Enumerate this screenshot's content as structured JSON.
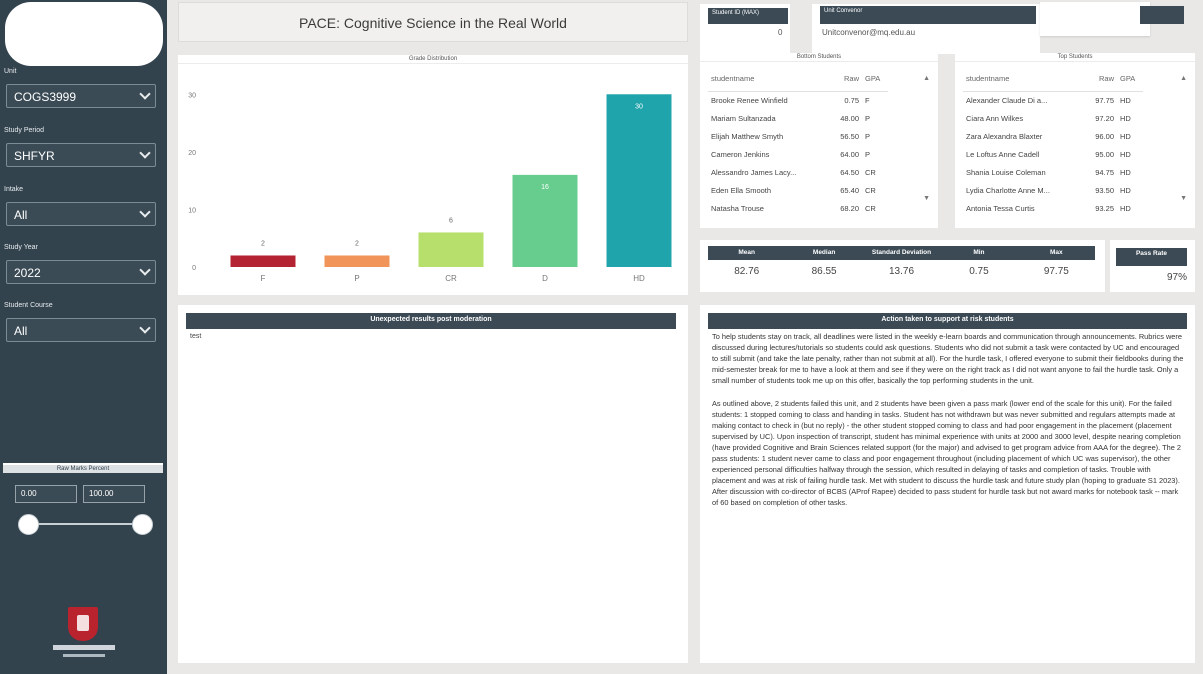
{
  "sidebar": {
    "filters": [
      {
        "label": "Unit",
        "value": "COGS3999"
      },
      {
        "label": "Study Period",
        "value": "SHFYR"
      },
      {
        "label": "Intake",
        "value": "All"
      },
      {
        "label": "Study Year",
        "value": "2022"
      },
      {
        "label": "Student Course",
        "value": "All"
      }
    ],
    "range": {
      "label": "Raw Marks Percent",
      "min": "0.00",
      "max": "100.00"
    }
  },
  "header": {
    "title": "PACE: Cognitive Science in the Real World",
    "student_id_label": "Student ID (MAX)",
    "student_id_value": "0",
    "email_label": "Unit Convenor",
    "email_value": "Unitconvenor@mq.edu.au"
  },
  "grade_distribution": {
    "title": "Grade Distribution"
  },
  "chart_data": {
    "type": "bar",
    "title": "Grade Distribution",
    "categories": [
      "F",
      "P",
      "CR",
      "D",
      "HD"
    ],
    "values": [
      2,
      2,
      6,
      16,
      30
    ],
    "ylim": [
      0,
      33
    ],
    "yticks": [
      "0",
      "10",
      "20",
      "30"
    ],
    "colors": [
      "#b42331",
      "#f0945a",
      "#b6e06b",
      "#66cd8e",
      "#20a4ab"
    ]
  },
  "bottom_students": {
    "title": "Bottom Students",
    "columns": [
      "studentname",
      "Raw",
      "GPA"
    ],
    "rows": [
      [
        "Brooke Renee Winfield",
        "0.75",
        "F"
      ],
      [
        "Mariam Sultanzada",
        "48.00",
        "P"
      ],
      [
        "Elijah Matthew Smyth",
        "56.50",
        "P"
      ],
      [
        "Cameron Jenkins",
        "64.00",
        "P"
      ],
      [
        "Alessandro James Lacy...",
        "64.50",
        "CR"
      ],
      [
        "Eden Ella Smooth",
        "65.40",
        "CR"
      ],
      [
        "Natasha Trouse",
        "68.20",
        "CR"
      ]
    ]
  },
  "top_students": {
    "title": "Top Students",
    "columns": [
      "studentname",
      "Raw",
      "GPA"
    ],
    "rows": [
      [
        "Alexander Claude Di a...",
        "97.75",
        "HD"
      ],
      [
        "Ciara Ann Wilkes",
        "97.20",
        "HD"
      ],
      [
        "Zara Alexandra Blaxter",
        "96.00",
        "HD"
      ],
      [
        "Le Loftus Anne Cadell",
        "95.00",
        "HD"
      ],
      [
        "Shania Louise Coleman",
        "94.75",
        "HD"
      ],
      [
        "Lydia Charlotte Anne M...",
        "93.50",
        "HD"
      ],
      [
        "Antonia Tessa Curtis",
        "93.25",
        "HD"
      ]
    ]
  },
  "stats": {
    "headers": [
      "Mean",
      "Median",
      "Standard Deviation",
      "Min",
      "Max"
    ],
    "values": [
      "82.76",
      "86.55",
      "13.76",
      "0.75",
      "97.75"
    ]
  },
  "pass_rate": {
    "label": "Pass Rate",
    "value": "97%"
  },
  "comments": {
    "title": "Unexpected results post moderation",
    "value": "test"
  },
  "actions": {
    "title": "Action taken to support at risk students",
    "paragraphs": [
      "To help students stay on track, all deadlines were listed in the weekly e-learn boards and communication through announcements. Rubrics were discussed during lectures/tutorials so students could ask questions. Students who did not submit a task were contacted by UC and encouraged to still submit (and take the late penalty, rather than not submit at all). For the hurdle task, I offered everyone to submit their fieldbooks during the mid-semester break for me to have a look at them and see if they were on the right track as I did not want anyone to fail the hurdle task. Only a small number of students took me up on this offer, basically the top performing students in the unit.",
      "As outlined above, 2 students failed this unit, and 2 students have been given a pass mark (lower end of the scale for this unit). For the failed students: 1 stopped coming to class and handing in tasks. Student has not withdrawn but was never submitted and regulars attempts made at making contact to check in (but no reply) - the other student stopped coming to class and had poor engagement in the placement (placement supervised by UC). Upon inspection of transcript, student has minimal experience with units at 2000 and 3000 level, despite nearing completion (have provided Cognitive and Brain Sciences related support (for the major) and advised to get program advice from AAA for the degree). The 2 pass students: 1 student never came to class and poor engagement throughout (including placement of which UC was supervisor), the other experienced personal difficulties halfway through the session, which resulted in delaying of tasks and completion of tasks. Trouble with placement and was at risk of failing hurdle task. Met with student to discuss the hurdle task and future study plan (hoping to graduate S1 2023). After discussion with co-director of BCBS (AProf Rapee) decided to pass student for hurdle task but not award marks for notebook task -- mark of 60 based on completion of other tasks."
    ]
  }
}
